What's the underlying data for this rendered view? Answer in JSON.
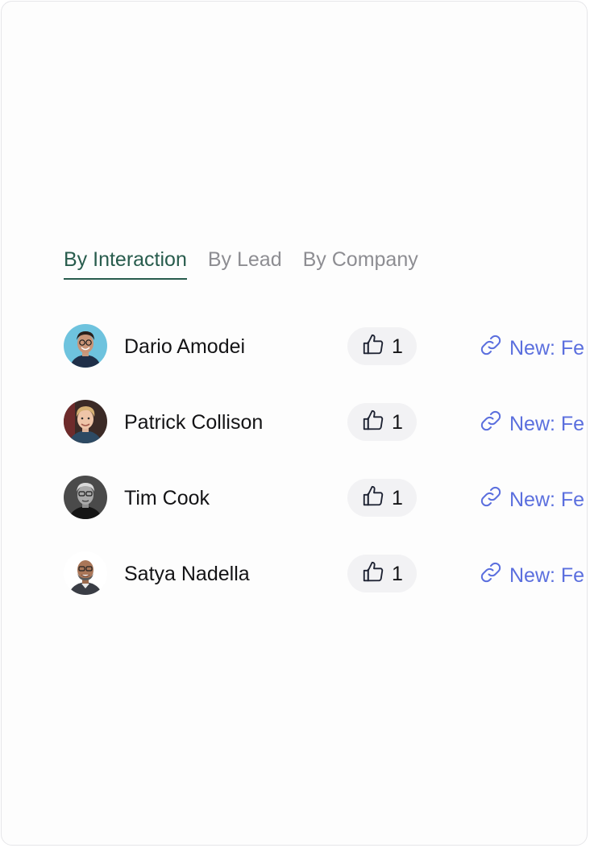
{
  "tabs": [
    {
      "label": "By Interaction",
      "active": true
    },
    {
      "label": "By Lead",
      "active": false
    },
    {
      "label": "By Company",
      "active": false
    }
  ],
  "rows": [
    {
      "name": "Dario Amodei",
      "reaction_icon": "thumbs-up-icon",
      "count": "1",
      "link_text": "New: Fe"
    },
    {
      "name": "Patrick Collison",
      "reaction_icon": "thumbs-up-icon",
      "count": "1",
      "link_text": "New: Fe"
    },
    {
      "name": "Tim Cook",
      "reaction_icon": "thumbs-up-icon",
      "count": "1",
      "link_text": "New: Fe"
    },
    {
      "name": "Satya Nadella",
      "reaction_icon": "thumbs-up-icon",
      "count": "1",
      "link_text": "New: Fe"
    }
  ],
  "colors": {
    "active_tab": "#285c4d",
    "inactive_tab": "#8d8d92",
    "link": "#5b6fde",
    "reaction_bg": "#f2f2f4"
  }
}
